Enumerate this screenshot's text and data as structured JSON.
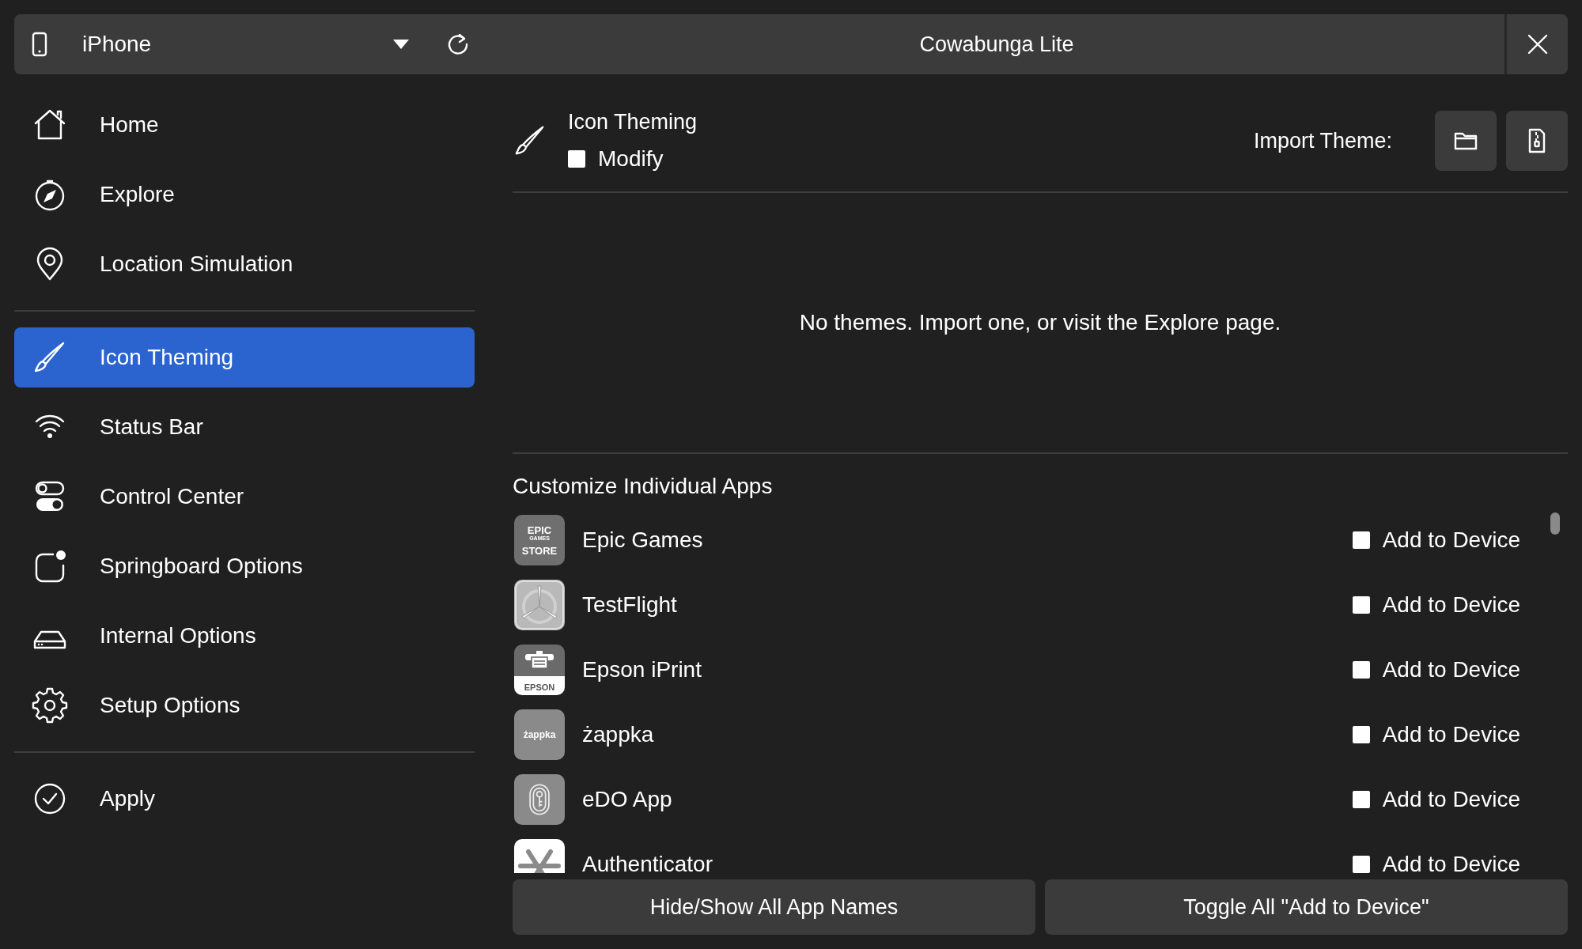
{
  "top_bar": {
    "device": "iPhone",
    "title": "Cowabunga Lite"
  },
  "sidebar": {
    "sections": [
      [
        {
          "kind": "home",
          "label": "Home",
          "selected": false
        },
        {
          "kind": "explore",
          "label": "Explore",
          "selected": false
        },
        {
          "kind": "location",
          "label": "Location Simulation",
          "selected": false
        }
      ],
      [
        {
          "kind": "theming",
          "label": "Icon Theming",
          "selected": true
        },
        {
          "kind": "statusbar",
          "label": "Status Bar",
          "selected": false
        },
        {
          "kind": "controlcenter",
          "label": "Control Center",
          "selected": false
        },
        {
          "kind": "springboard",
          "label": "Springboard Options",
          "selected": false
        },
        {
          "kind": "internal",
          "label": "Internal Options",
          "selected": false
        },
        {
          "kind": "setup",
          "label": "Setup Options",
          "selected": false
        }
      ],
      [
        {
          "kind": "apply",
          "label": "Apply",
          "selected": false
        }
      ]
    ]
  },
  "header": {
    "title": "Icon Theming",
    "modify": {
      "label": "Modify",
      "checked": false
    },
    "import_label": "Import Theme:"
  },
  "empty_message": "No themes. Import one, or visit the Explore page.",
  "apps_title": "Customize Individual Apps",
  "apps": [
    {
      "kind": "epic",
      "name": "Epic Games",
      "icon_text": [
        "EPIC",
        "GAMES",
        "STORE"
      ],
      "add_label": "Add to Device",
      "checked": false
    },
    {
      "kind": "testflight",
      "name": "TestFlight",
      "add_label": "Add to Device",
      "checked": false
    },
    {
      "kind": "epson",
      "name": "Epson iPrint",
      "icon_text": [
        "EPSON"
      ],
      "add_label": "Add to Device",
      "checked": false
    },
    {
      "kind": "zappka",
      "name": "żappka",
      "icon_text": [
        "żappka"
      ],
      "add_label": "Add to Device",
      "checked": false
    },
    {
      "kind": "edo",
      "name": "eDO App",
      "add_label": "Add to Device",
      "checked": false
    },
    {
      "kind": "authenticator",
      "name": "Authenticator",
      "add_label": "Add to Device",
      "checked": false
    }
  ],
  "buttons": [
    "Hide/Show All App Names",
    "Toggle All \"Add to Device\""
  ]
}
